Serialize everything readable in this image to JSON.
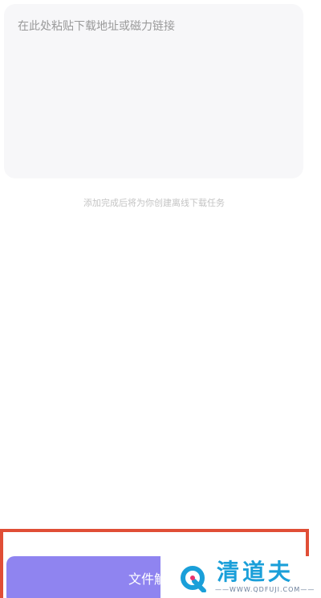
{
  "link_input": {
    "placeholder": "在此处粘贴下载地址或磁力链接",
    "value": ""
  },
  "hint_text": "添加完成后将为你创建离线下载任务",
  "parse_button": {
    "label": "文件解"
  },
  "watermark": {
    "name": "清道夫",
    "url": "——WWW.QDFUJI.COM——"
  },
  "colors": {
    "highlight_border": "#e04e36",
    "button_bg": "#8f84f0",
    "watermark_blue": "#1a9fd9",
    "watermark_pink": "#e8336d"
  }
}
